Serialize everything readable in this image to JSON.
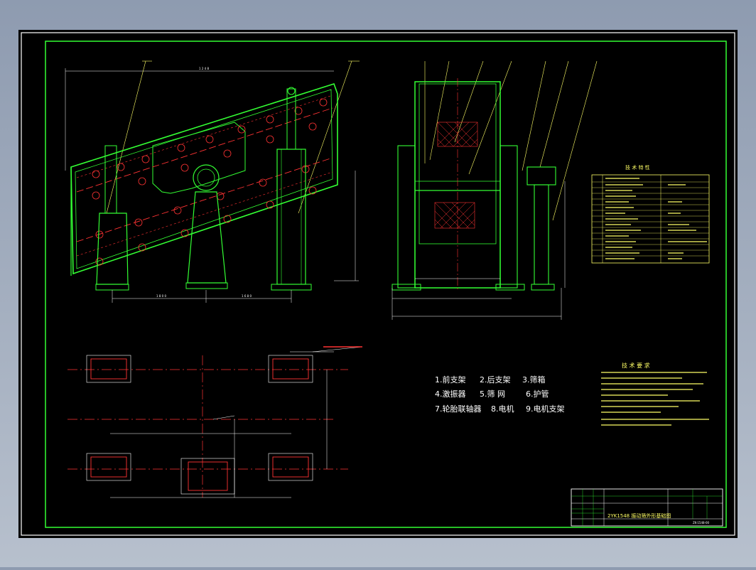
{
  "drawing": {
    "parts_list": [
      "1.前支架",
      "2.后支架",
      "3.筛箱",
      "4.激振器",
      "5.筛 网",
      "6.护管",
      "7.轮胎联轴器",
      "8.电机",
      "9.电机支架"
    ],
    "tech_spec_title": "技 术 特 性",
    "tech_req_title": "技 术 要 求",
    "title_block": {
      "drawing_title": "2YK1548 振动筛外形基础图",
      "code": "ZK-1548-00"
    },
    "colors": {
      "frame": "#33ff33",
      "border": "#ffffff",
      "text": "#ffff66",
      "centerline": "#ff3333",
      "parts_text": "#ffffff",
      "background": "#000000"
    }
  }
}
